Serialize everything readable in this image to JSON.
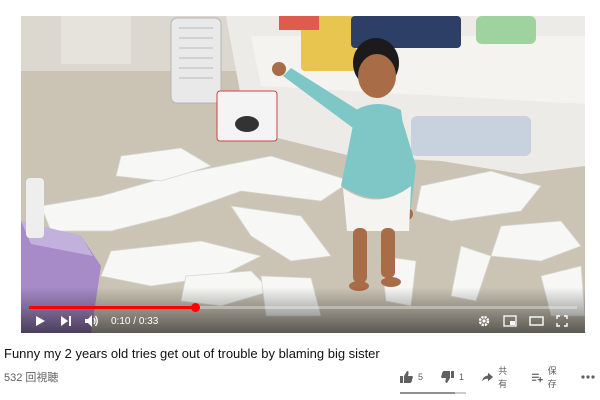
{
  "video": {
    "current_time": "0:10",
    "duration": "0:33",
    "time_separator": " / ",
    "progress": 0.303
  },
  "title": "Funny my 2 years old tries get out of trouble by blaming big sister",
  "views": "532 回視聴",
  "actions": {
    "likes": "5",
    "dislikes": "1",
    "share_label": "共有",
    "save_label": "保存",
    "like_ratio": 0.83
  },
  "colors": {
    "progress": "#ff0000",
    "meta_text": "#606060"
  },
  "icons": [
    "play-icon",
    "next-icon",
    "volume-icon",
    "settings-icon",
    "miniplayer-icon",
    "theater-icon",
    "fullscreen-icon",
    "like-icon",
    "dislike-icon",
    "share-icon",
    "add-to-playlist-icon",
    "more-icon"
  ]
}
